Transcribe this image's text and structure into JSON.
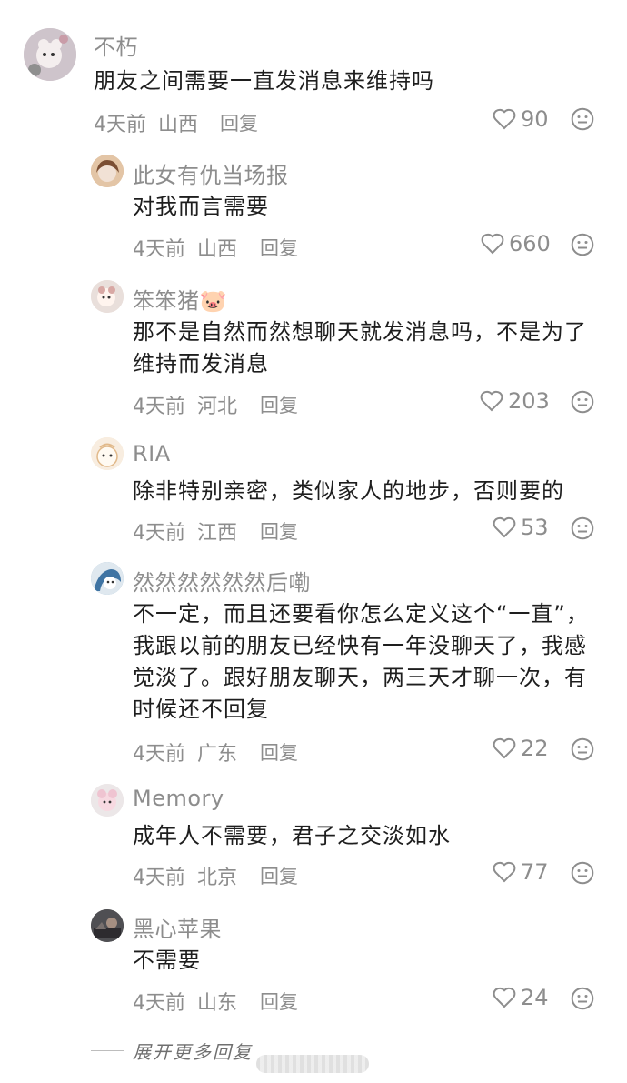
{
  "comments": [
    {
      "kind": "main",
      "user": "不朽",
      "text": "朋友之间需要一直发消息来维持吗",
      "time": "4天前",
      "location": "山西",
      "reply_label": "回复",
      "likes": "90",
      "avatar_color": "#d9d1d6"
    },
    {
      "kind": "reply",
      "user": "此女有仇当场报",
      "text": "对我而言需要",
      "time": "4天前",
      "location": "山西",
      "reply_label": "回复",
      "likes": "660",
      "avatar_color": "#d7b48d"
    },
    {
      "kind": "reply",
      "user": "笨笨猪🐷",
      "text": "那不是自然而然想聊天就发消息吗，不是为了维持而发消息",
      "time": "4天前",
      "location": "河北",
      "reply_label": "回复",
      "likes": "203",
      "avatar_color": "#e7d8d1"
    },
    {
      "kind": "reply",
      "user": "RIA",
      "text": "除非特别亲密，类似家人的地步，否则要的",
      "time": "4天前",
      "location": "江西",
      "reply_label": "回复",
      "likes": "53",
      "avatar_color": "#f3e3c8"
    },
    {
      "kind": "reply",
      "user": "然然然然然然后嘞",
      "text": "不一定，而且还要看你怎么定义这个“一直”，我跟以前的朋友已经快有一年没聊天了，我感觉淡了。跟好朋友聊天，两三天才聊一次，有时候还不回复",
      "time": "4天前",
      "location": "广东",
      "reply_label": "回复",
      "likes": "22",
      "avatar_color": "#8fb2ce"
    },
    {
      "kind": "reply",
      "user": "Memory",
      "text": "成年人不需要，君子之交淡如水",
      "time": "4天前",
      "location": "北京",
      "reply_label": "回复",
      "likes": "77",
      "avatar_color": "#e8dfe2"
    },
    {
      "kind": "reply",
      "user": "黑心苹果",
      "text": "不需要",
      "time": "4天前",
      "location": "山东",
      "reply_label": "回复",
      "likes": "24",
      "avatar_color": "#4d4b4b"
    }
  ],
  "more_replies_label": "展开更多回复",
  "colors": {
    "meta_gray": "#8d8d8d",
    "text_dark": "#1e1e1e",
    "line_gray": "#bdbdbd"
  },
  "icons": {
    "like": "heart-icon",
    "emoji": "emoji-face-icon"
  }
}
